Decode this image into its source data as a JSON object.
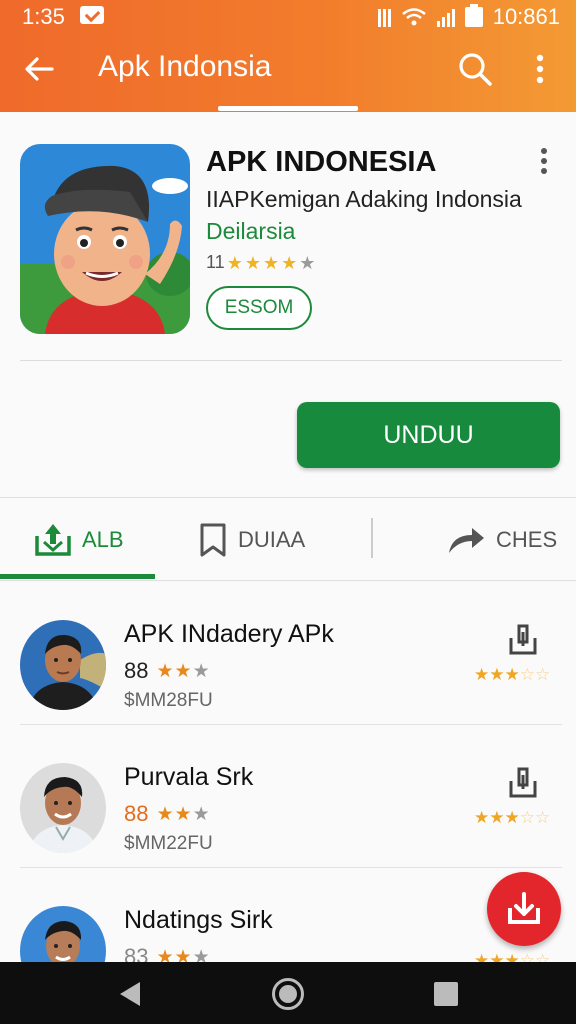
{
  "status_bar": {
    "time": "1:35",
    "clock_right": "10:861"
  },
  "appbar": {
    "title": "Apk Indonsia"
  },
  "app": {
    "name": "APK INDONESIA",
    "subtitle": "IIAPKemigan Adaking Indonsia",
    "developer": "Deilarsia",
    "rating_count": "11",
    "rating_stars": 4,
    "chip_label": "ESSOM",
    "install_label": "UNDUU"
  },
  "tabs": [
    {
      "label": "ALB",
      "icon": "install-tray-icon",
      "active": true
    },
    {
      "label": "DUIAA",
      "icon": "bookmark-icon",
      "active": false
    },
    {
      "label": "CHES",
      "icon": "share-icon",
      "active": false
    }
  ],
  "list": [
    {
      "name": "APK INdadery APk",
      "score": "88",
      "score_stars": 2,
      "price": "$MM28FU",
      "right_stars": 3
    },
    {
      "name": "Purvala Srk",
      "score": "88",
      "score_stars": 2,
      "price": "$MM22FU",
      "right_stars": 3
    },
    {
      "name": "Ndatings Sirk",
      "score": "83",
      "score_stars": 2,
      "price": "",
      "right_stars": 3
    }
  ],
  "colors": {
    "header": "#ef6a2b",
    "accent_green": "#178a3d",
    "fab_red": "#e3262b"
  }
}
